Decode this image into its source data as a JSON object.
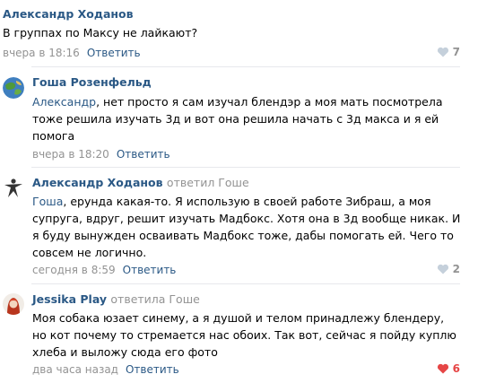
{
  "comments": [
    {
      "author": "Александр Ходанов",
      "text": "В группах по Максу не лайкают?",
      "time": "вчера в 18:16",
      "reply_label": "Ответить",
      "likes": "7"
    },
    {
      "author": "Гоша Розенфельд",
      "mention": "Александр",
      "text": ", нет просто я сам изучал блендэр а моя мать посмотрела тоже решила изучать 3д и вот она решила начать с 3д макса и я ей помога",
      "time": "вчера в 18:20",
      "reply_label": "Ответить"
    },
    {
      "author": "Александр Ходанов",
      "replied_to": "ответил Гоше",
      "mention": "Гоша",
      "text": ", ерунда какая-то. Я использую в своей работе Зибраш, а моя супруга, вдруг, решит изучать Мадбокс. Хотя она в 3д вообще никак. И я буду вынужден осваивать Мадбокс тоже, дабы помогать ей. Чего то совсем не логично.",
      "time": "сегодня в 8:59",
      "reply_label": "Ответить",
      "likes": "2"
    },
    {
      "author": "Jessika Play",
      "replied_to": "ответила Гоше",
      "text": "Моя собака юзает синему, а я душой и телом принадлежу блендеру, но кот почему то стремается нас обоих. Так вот, сейчас я пойду куплю хлеба и выложу сюда его фото",
      "time": "два часа назад",
      "reply_label": "Ответить",
      "likes": "6"
    }
  ],
  "icons": {
    "like": "heart-icon",
    "avatar_2": "avatar-globe-icon",
    "avatar_3": "avatar-zbrush-icon",
    "avatar_4": "avatar-girl-icon"
  },
  "colors": {
    "link": "#2a5885",
    "meta": "#939393",
    "liked": "#e64646",
    "divider": "#e7e8ec"
  }
}
